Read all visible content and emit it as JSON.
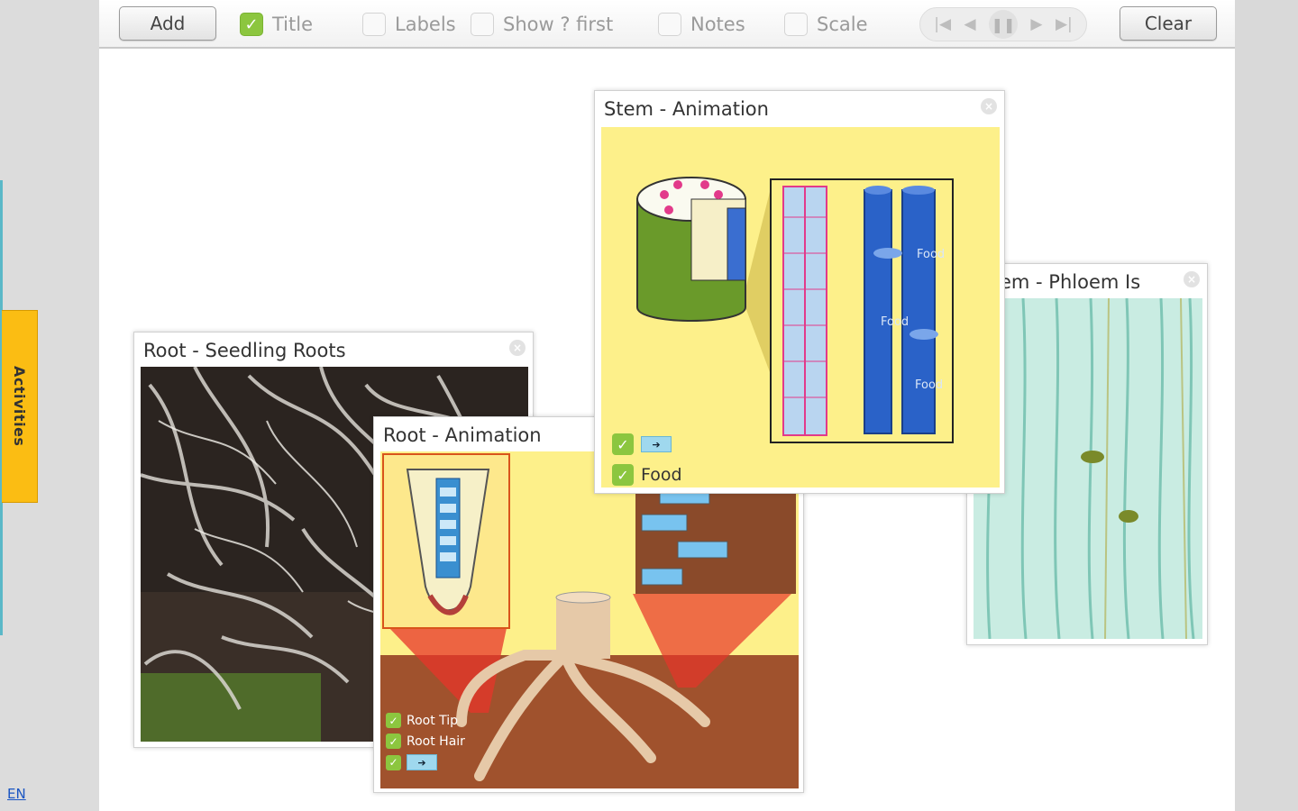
{
  "toolbar": {
    "add_label": "Add",
    "clear_label": "Clear",
    "options": [
      {
        "label": "Title",
        "checked": true
      },
      {
        "label": "Labels",
        "checked": false
      },
      {
        "label": "Show ? first",
        "checked": false
      },
      {
        "label": "Notes",
        "checked": false
      },
      {
        "label": "Scale",
        "checked": false
      }
    ],
    "player": {
      "first": "|◀",
      "prev": "◀",
      "pause": "❚❚",
      "next": "▶",
      "last": "▶|"
    }
  },
  "sidebar": {
    "activities_label": "Activities",
    "language": "EN"
  },
  "panels": {
    "seedling": {
      "title": "Root - Seedling Roots"
    },
    "root_anim": {
      "title": "Root - Animation",
      "checks": [
        "Root Tip",
        "Root Hair"
      ]
    },
    "stem_anim": {
      "title": "Stem - Animation",
      "food_label": "Food",
      "diagram_labels": [
        "Food",
        "Food",
        "Food"
      ]
    },
    "phloem": {
      "title": "em - Phloem Is"
    }
  },
  "colors": {
    "check_green": "#8cc63f",
    "activities_tab": "#fbbd13",
    "animation_bg": "#fdf08a"
  }
}
